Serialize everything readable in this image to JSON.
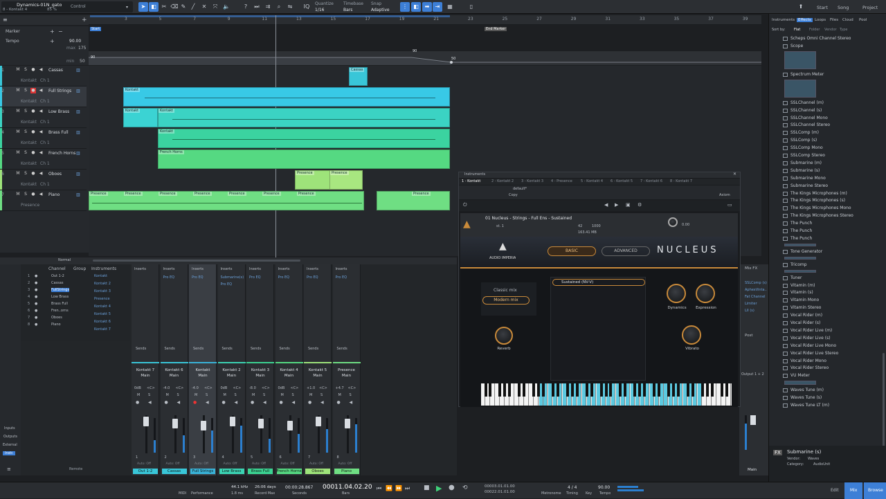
{
  "toolbar": {
    "song_name": "Dynamics-01N_gato",
    "song_sub": "8 - Kontakt 4",
    "cpu": "85 %",
    "control_label": "Control",
    "quantize_label": "Quantize",
    "quantize_value": "1/16",
    "timebase_label": "Timebase",
    "timebase_value": "Bars",
    "snap_label": "Snap",
    "snap_value": "Adaptive",
    "nav": [
      "Start",
      "Song",
      "Project"
    ]
  },
  "ruler": {
    "numbers": [
      "3",
      "5",
      "7",
      "9",
      "11",
      "13",
      "15",
      "17",
      "19",
      "21",
      "23",
      "25",
      "27",
      "29",
      "31",
      "33",
      "35",
      "37",
      "39"
    ],
    "start_marker": "Start",
    "end_marker": "End Marker"
  },
  "global_tracks": {
    "marker": "Marker",
    "tempo": "Tempo",
    "tempo_value": "90.00",
    "max_label": "max",
    "max_value": "175",
    "min_label": "min",
    "min_value": "50",
    "pt_a": "90",
    "pt_b": "90",
    "pt_c": "50"
  },
  "tracks": [
    {
      "num": "1",
      "name": "Cassas",
      "sub": "Kontakt",
      "ch": "Ch 1"
    },
    {
      "num": "2",
      "name": "Full Strings",
      "sub": "Kontakt",
      "ch": "Ch 1"
    },
    {
      "num": "3",
      "name": "Low Brass",
      "sub": "Kontakt",
      "ch": "Ch 1"
    },
    {
      "num": "4",
      "name": "Brass Full",
      "sub": "Kontakt",
      "ch": "Ch 1"
    },
    {
      "num": "5",
      "name": "French Horns",
      "sub": "Kontakt",
      "ch": "Ch 1"
    },
    {
      "num": "6",
      "name": "Oboes",
      "sub": "Kontakt",
      "ch": "Ch 1"
    },
    {
      "num": "7",
      "name": "Piano",
      "sub": "Presence",
      "ch": ""
    }
  ],
  "clips": {
    "cassas": "Cassas",
    "kontakt": "Kontakt",
    "french_horns": "French Horns",
    "presence": "Presence"
  },
  "mixer": {
    "list_header": [
      "Channel",
      "Group",
      "Instruments"
    ],
    "channels": [
      "Out 1-2",
      "Cassas",
      "FullStrings",
      "Low Brass",
      "Brass Full",
      "Fren..orns",
      "Oboes",
      "Piano"
    ],
    "instruments": [
      "Kontakt",
      "Kontakt 2",
      "Kontakt 3",
      "Presence",
      "Kontakt 4",
      "Kontakt 5",
      "Kontakt 6",
      "Kontakt 7"
    ],
    "mode": "Normal",
    "inserts_label": "Inserts",
    "sends_label": "Sends",
    "side": [
      "Inputs",
      "Outputs",
      "External",
      "Instr.",
      "Remote"
    ],
    "strips": [
      {
        "inst": "Kontakt 7",
        "bus": "Main",
        "db": "0dB",
        "pan": "<C>",
        "insert": "",
        "name": "Out 1-2",
        "num": "1",
        "color": "#39c6d8"
      },
      {
        "inst": "Kontakt 6",
        "bus": "Main",
        "db": "-4.0",
        "pan": "<C>",
        "insert": "Pro EQ",
        "name": "Cassas",
        "num": "2",
        "color": "#39c6d8"
      },
      {
        "inst": "Kontakt",
        "bus": "Main",
        "db": "-4.0",
        "pan": "<C>",
        "insert": "Pro EQ",
        "name": "Full Strings",
        "num": "3",
        "color": "#39b3d8"
      },
      {
        "inst": "Kontakt 2",
        "bus": "Main",
        "db": "0dB",
        "pan": "<C>",
        "insert": "Submarine(s)",
        "name": "Low Brass",
        "num": "4",
        "color": "#3bd3b3"
      },
      {
        "inst": "Kontakt 3",
        "bus": "Main",
        "db": "-8.0",
        "pan": "<C>",
        "insert": "Pro EQ",
        "name": "Brass Full",
        "num": "5",
        "color": "#3bd392"
      },
      {
        "inst": "Kontakt 4",
        "bus": "Main",
        "db": "0dB",
        "pan": "<C>",
        "insert": "Pro EQ",
        "name": "French Horns",
        "num": "6",
        "color": "#55d982"
      },
      {
        "inst": "Kontakt 5",
        "bus": "Main",
        "db": "+1.0",
        "pan": "<C>",
        "insert": "Pro EQ",
        "name": "Oboes",
        "num": "7",
        "color": "#9ee37a"
      },
      {
        "inst": "Presence",
        "bus": "Main",
        "db": "+4.7",
        "pan": "<C>",
        "insert": "Pro EQ",
        "name": "Piano",
        "num": "8",
        "color": "#6fde83"
      }
    ],
    "insert_extra": "Pro EQ",
    "auto_off": "Auto: Off",
    "main_label": "Main",
    "mixfx": "Mix FX",
    "main_inserts": [
      "SSLComp (s)",
      "AphexVinta..",
      "Fat Channel",
      "Limiter",
      "LII (s)"
    ],
    "post": "Post",
    "output": "Output 1 + 2"
  },
  "plugin": {
    "title": "Instruments",
    "tabs": [
      "1 - Kontakt",
      "2 - Kontakt 2",
      "3 - Kontakt 3",
      "4 - Presence",
      "5 - Kontakt 4",
      "6 - Kontakt 5",
      "7 - Kontakt 6",
      "8 - Kontakt 7"
    ],
    "preset": "default*",
    "copy": "Copy",
    "instrument": "01 Nucleus - Strings - Full Ens - Sustained",
    "output": "st. 1",
    "voices": "42",
    "max": "1000",
    "memory": "163.41 MB",
    "tune": "0.00",
    "basic": "BASIC",
    "advanced": "ADVANCED",
    "logo": "NUCLEUS",
    "brand": "AUDIO IMPERIA",
    "classic_mix": "Classic mix",
    "modern_mix": "Modern mix",
    "articulation": "Sustained (NV-V)",
    "knobs": [
      "Dynamics",
      "Expression",
      "Reverb",
      "Vibrato"
    ],
    "axiom": "Axiom"
  },
  "browser": {
    "tabs": [
      "Instruments",
      "Effects",
      "Loops",
      "Files",
      "Cloud",
      "Pool"
    ],
    "sort_by": "Sort by:",
    "sort_opts": [
      "Flat",
      "Folder",
      "Vendor",
      "Type"
    ],
    "items": [
      "Scheps Omni Channel Stereo",
      "Scope",
      "Spectrum Meter",
      "SSLChannel (m)",
      "SSLChannel (s)",
      "SSLChannel Mono",
      "SSLChannel Stereo",
      "SSLComp (m)",
      "SSLComp (s)",
      "SSLComp Mono",
      "SSLComp Stereo",
      "Submarine (m)",
      "Submarine (s)",
      "Submarine Mono",
      "Submarine Stereo",
      "The Kings Microphones (m)",
      "The Kings Microphones (s)",
      "The Kings Microphones Mono",
      "The Kings Microphones Stereo",
      "The Punch",
      "The Punch",
      "The Punch",
      "Tone Generator",
      "Tricomp",
      "Tuner",
      "Vitamin (m)",
      "Vitamin (s)",
      "Vitamin Mono",
      "Vitamin Stereo",
      "Vocal Rider (m)",
      "Vocal Rider (s)",
      "Vocal Rider Live (m)",
      "Vocal Rider Live (s)",
      "Vocal Rider Live Mono",
      "Vocal Rider Live Stereo",
      "Vocal Rider Mono",
      "Vocal Rider Stereo",
      "VU Meter",
      "Waves Tune (m)",
      "Waves Tune (s)",
      "Waves Tune LT (m)"
    ],
    "info_name": "Submarine (s)",
    "info_vendor_label": "Vendor:",
    "info_vendor": "Waves",
    "info_cat_label": "Category:",
    "info_cat": "AudioUnit"
  },
  "transport": {
    "sample_rate": "44.1 kHz",
    "latency": "1.8 ms",
    "midi": "MIDI",
    "performance": "Performance",
    "days": "26:06 days",
    "record_max": "Record Max",
    "seconds_val": "00:00:28.867",
    "seconds": "Seconds",
    "bars_val": "00011.04.02.20",
    "bars": "Bars",
    "loop_l": "00003.01.01.00",
    "loop_r": "00022.01.01.00",
    "metronome": "Metronome",
    "timing": "Timing",
    "sig": "4 / 4",
    "key": "Key",
    "tempo": "90.00",
    "tempo_label": "Tempo",
    "edit": "Edit",
    "mix": "Mix",
    "browse": "Browse"
  }
}
